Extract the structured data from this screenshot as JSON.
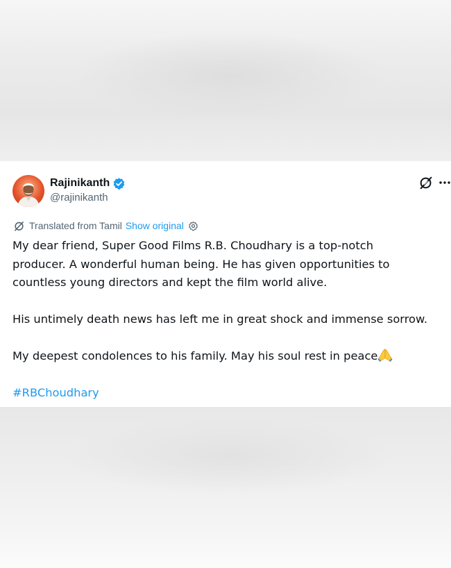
{
  "tweet": {
    "author_name": "Rajinikanth",
    "author_handle": "@rajinikanth",
    "translation": {
      "label": "Translated from Tamil",
      "show_original": "Show original"
    },
    "lines": [
      "My dear friend, Super Good Films R.B. Choudhary is a top-notch",
      "producer. A wonderful human being. He has given opportunities to",
      "countless young directors and kept the film world alive.",
      "His untimely death news has left me in great shock and immense sorrow.",
      "My deepest condolences to his family. May his soul rest in peace"
    ],
    "hashtag": "#RBChoudhary",
    "icons": {
      "avatar": "profile-photo",
      "verified": "verified-badge-icon",
      "grok": "grok-icon",
      "more": "more-options-icon",
      "translate": "translate-icon",
      "settings": "settings-gear-icon",
      "emoji": "folded-hands-emoji"
    },
    "colors": {
      "link": "#1d9bf0",
      "text": "#0f1419",
      "secondary": "#536471"
    }
  }
}
